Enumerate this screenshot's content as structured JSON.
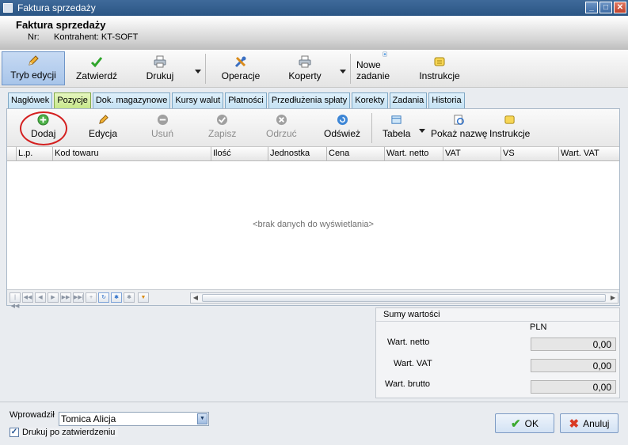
{
  "window": {
    "title": "Faktura sprzedaży"
  },
  "header": {
    "doc_title": "Faktura sprzedaży",
    "nr_label": "Nr:",
    "contractor": "Kontrahent: KT-SOFT"
  },
  "toolbar": {
    "edit_mode": "Tryb edycji",
    "approve": "Zatwierdź",
    "print": "Drukuj",
    "operations": "Operacje",
    "envelopes": "Koperty",
    "new_task": "Nowe zadanie",
    "instructions": "Instrukcje"
  },
  "tabs": [
    "Nagłówek",
    "Pozycje",
    "Dok. magazynowe",
    "Kursy walut",
    "Płatności",
    "Przedłużenia spłaty",
    "Korekty",
    "Zadania",
    "Historia"
  ],
  "active_tab": "Pozycje",
  "panel_toolbar": {
    "add": "Dodaj",
    "edit": "Edycja",
    "delete": "Usuń",
    "save": "Zapisz",
    "reject": "Odrzuć",
    "refresh": "Odśwież",
    "table": "Tabela",
    "show_name": "Pokaż nazwę",
    "instructions": "Instrukcje"
  },
  "grid": {
    "columns": [
      "L.p.",
      "Kod towaru",
      "Ilość",
      "Jednostka",
      "Cena",
      "Wart. netto",
      "VAT",
      "VS",
      "Wart. VAT"
    ],
    "empty_text": "<brak danych do wyświetlania>"
  },
  "sums": {
    "title": "Sumy wartości",
    "currency": "PLN",
    "rows": [
      {
        "label": "Wart. netto",
        "value": "0,00"
      },
      {
        "label": "Wart. VAT",
        "value": "0,00"
      },
      {
        "label": "Wart. brutto",
        "value": "0,00"
      }
    ]
  },
  "footer": {
    "entered_by_label": "Wprowadził",
    "entered_by_value": "Tomica Alicja",
    "print_after_approval": "Drukuj po zatwierdzeniu",
    "print_after_approval_checked": true,
    "ok": "OK",
    "cancel": "Anuluj"
  },
  "colors": {
    "highlight_circle": "#d42020",
    "active_tab": "#c7e88a",
    "title_bar": "#2a5584"
  }
}
